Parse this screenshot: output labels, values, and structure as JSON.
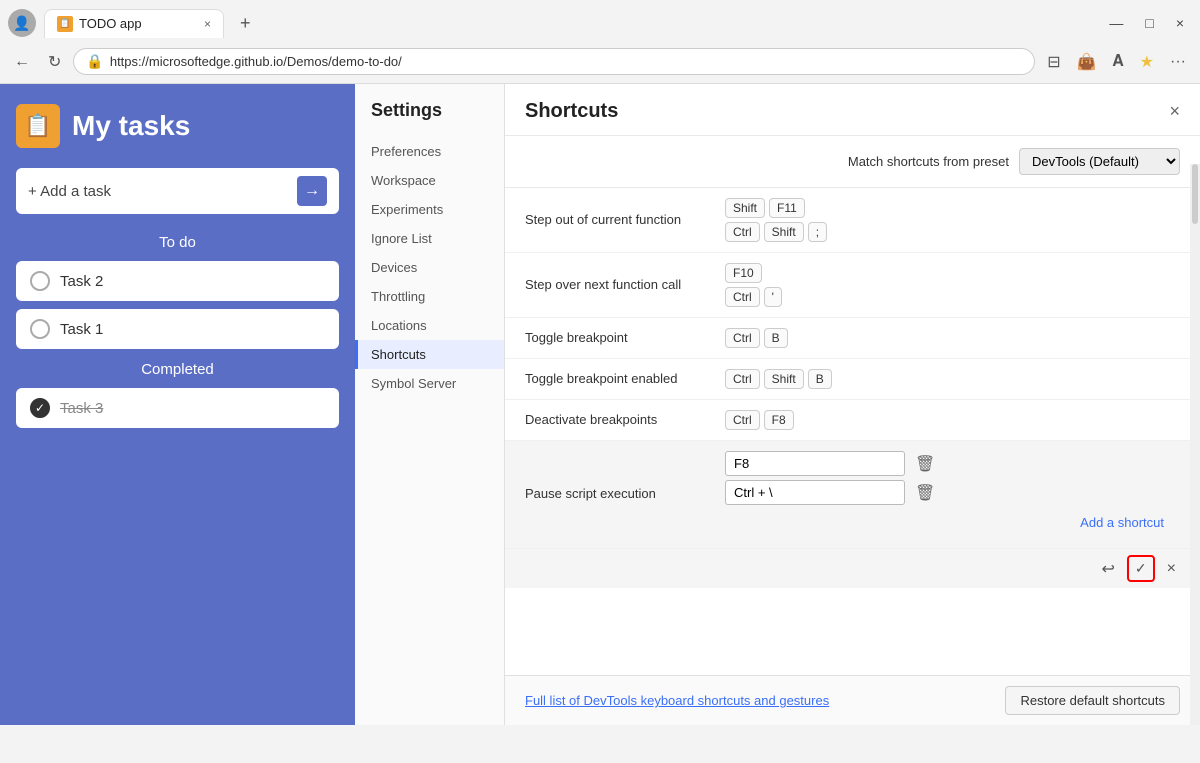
{
  "browser": {
    "tab_title": "TODO app",
    "tab_close": "×",
    "tab_new": "+",
    "address": "https://microsoftedge.github.io/Demos/demo-to-do/",
    "back_icon": "←",
    "refresh_icon": "↻",
    "minimize": "—",
    "maximize": "□",
    "close": "×",
    "more_icon": "···"
  },
  "todo": {
    "title": "My tasks",
    "add_placeholder": "+ Add a task",
    "sections": [
      {
        "name": "To do",
        "tasks": [
          {
            "label": "Task 2",
            "done": false
          },
          {
            "label": "Task 1",
            "done": false
          }
        ]
      },
      {
        "name": "Completed",
        "tasks": [
          {
            "label": "Task 3",
            "done": true
          }
        ]
      }
    ]
  },
  "settings": {
    "title": "Settings",
    "nav_items": [
      {
        "label": "Preferences",
        "active": false
      },
      {
        "label": "Workspace",
        "active": false
      },
      {
        "label": "Experiments",
        "active": false
      },
      {
        "label": "Ignore List",
        "active": false
      },
      {
        "label": "Devices",
        "active": false
      },
      {
        "label": "Throttling",
        "active": false
      },
      {
        "label": "Locations",
        "active": false
      },
      {
        "label": "Shortcuts",
        "active": true
      },
      {
        "label": "Symbol Server",
        "active": false
      }
    ]
  },
  "shortcuts": {
    "title": "Shortcuts",
    "preset_label": "Match shortcuts from preset",
    "preset_value": "DevTools (Default)",
    "items": [
      {
        "name": "Step out of current function",
        "key_groups": [
          [
            "Shift",
            "F11"
          ],
          [
            "Ctrl",
            "Shift",
            ";"
          ]
        ]
      },
      {
        "name": "Step over next function call",
        "key_groups": [
          [
            "F10"
          ],
          [
            "Ctrl",
            "'"
          ]
        ]
      },
      {
        "name": "Toggle breakpoint",
        "key_groups": [
          [
            "Ctrl",
            "B"
          ]
        ]
      },
      {
        "name": "Toggle breakpoint enabled",
        "key_groups": [
          [
            "Ctrl",
            "Shift",
            "B"
          ]
        ]
      },
      {
        "name": "Deactivate breakpoints",
        "key_groups": [
          [
            "Ctrl",
            "F8"
          ]
        ]
      }
    ],
    "editing_item": {
      "name": "Pause script execution",
      "inputs": [
        "F8",
        "Ctrl + \\"
      ],
      "add_shortcut_label": "Add a shortcut",
      "highlighted": true
    },
    "footer": {
      "full_list_link": "Full list of DevTools keyboard shortcuts and gestures",
      "restore_btn": "Restore default shortcuts"
    },
    "actions": {
      "undo_icon": "↩",
      "confirm_icon": "✓",
      "close_icon": "×"
    }
  }
}
